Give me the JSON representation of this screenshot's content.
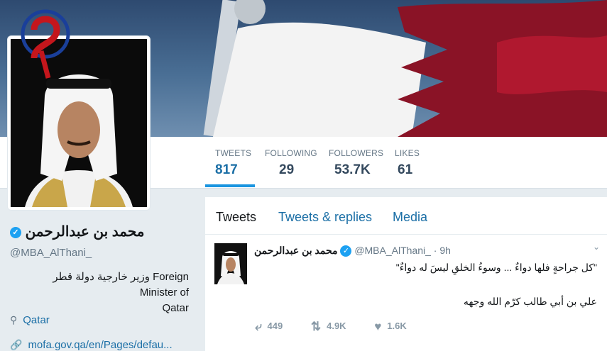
{
  "banner": {
    "description_icon": "flag-banner"
  },
  "site_logo": {
    "icon": "site-logo-icon"
  },
  "stats": [
    {
      "label": "TWEETS",
      "value": "817"
    },
    {
      "label": "FOLLOWING",
      "value": "29"
    },
    {
      "label": "FOLLOWERS",
      "value": "53.7K"
    },
    {
      "label": "LIKES",
      "value": "61"
    }
  ],
  "profile": {
    "name": "محمد بن عبدالرحمن",
    "handle": "@MBA_AlThani_",
    "bio_line1": "وزير خارجية دولة قطر Foreign Minister of",
    "bio_line2": "Qatar",
    "location": "Qatar",
    "website": "mofa.gov.qa/en/Pages/defau..."
  },
  "tabs": [
    "Tweets",
    "Tweets & replies",
    "Media"
  ],
  "tweet": {
    "name": "محمد بن عبدالرحمن",
    "handle": "@MBA_AlThani_",
    "sep": "·",
    "time": "9h",
    "line1": "\"كل جراحةٍ فلها دواءٌ ... وسوءُ الخلقِ ليسَ له دواءٌ\"",
    "line2": "علي بن أبي طالب كرّم الله وجهه",
    "replies": "449",
    "retweets": "4.9K",
    "likes": "1.6K"
  },
  "colors": {
    "accent": "#1b95e0",
    "link": "#1b6fa6",
    "verified": "#1da1f2"
  }
}
